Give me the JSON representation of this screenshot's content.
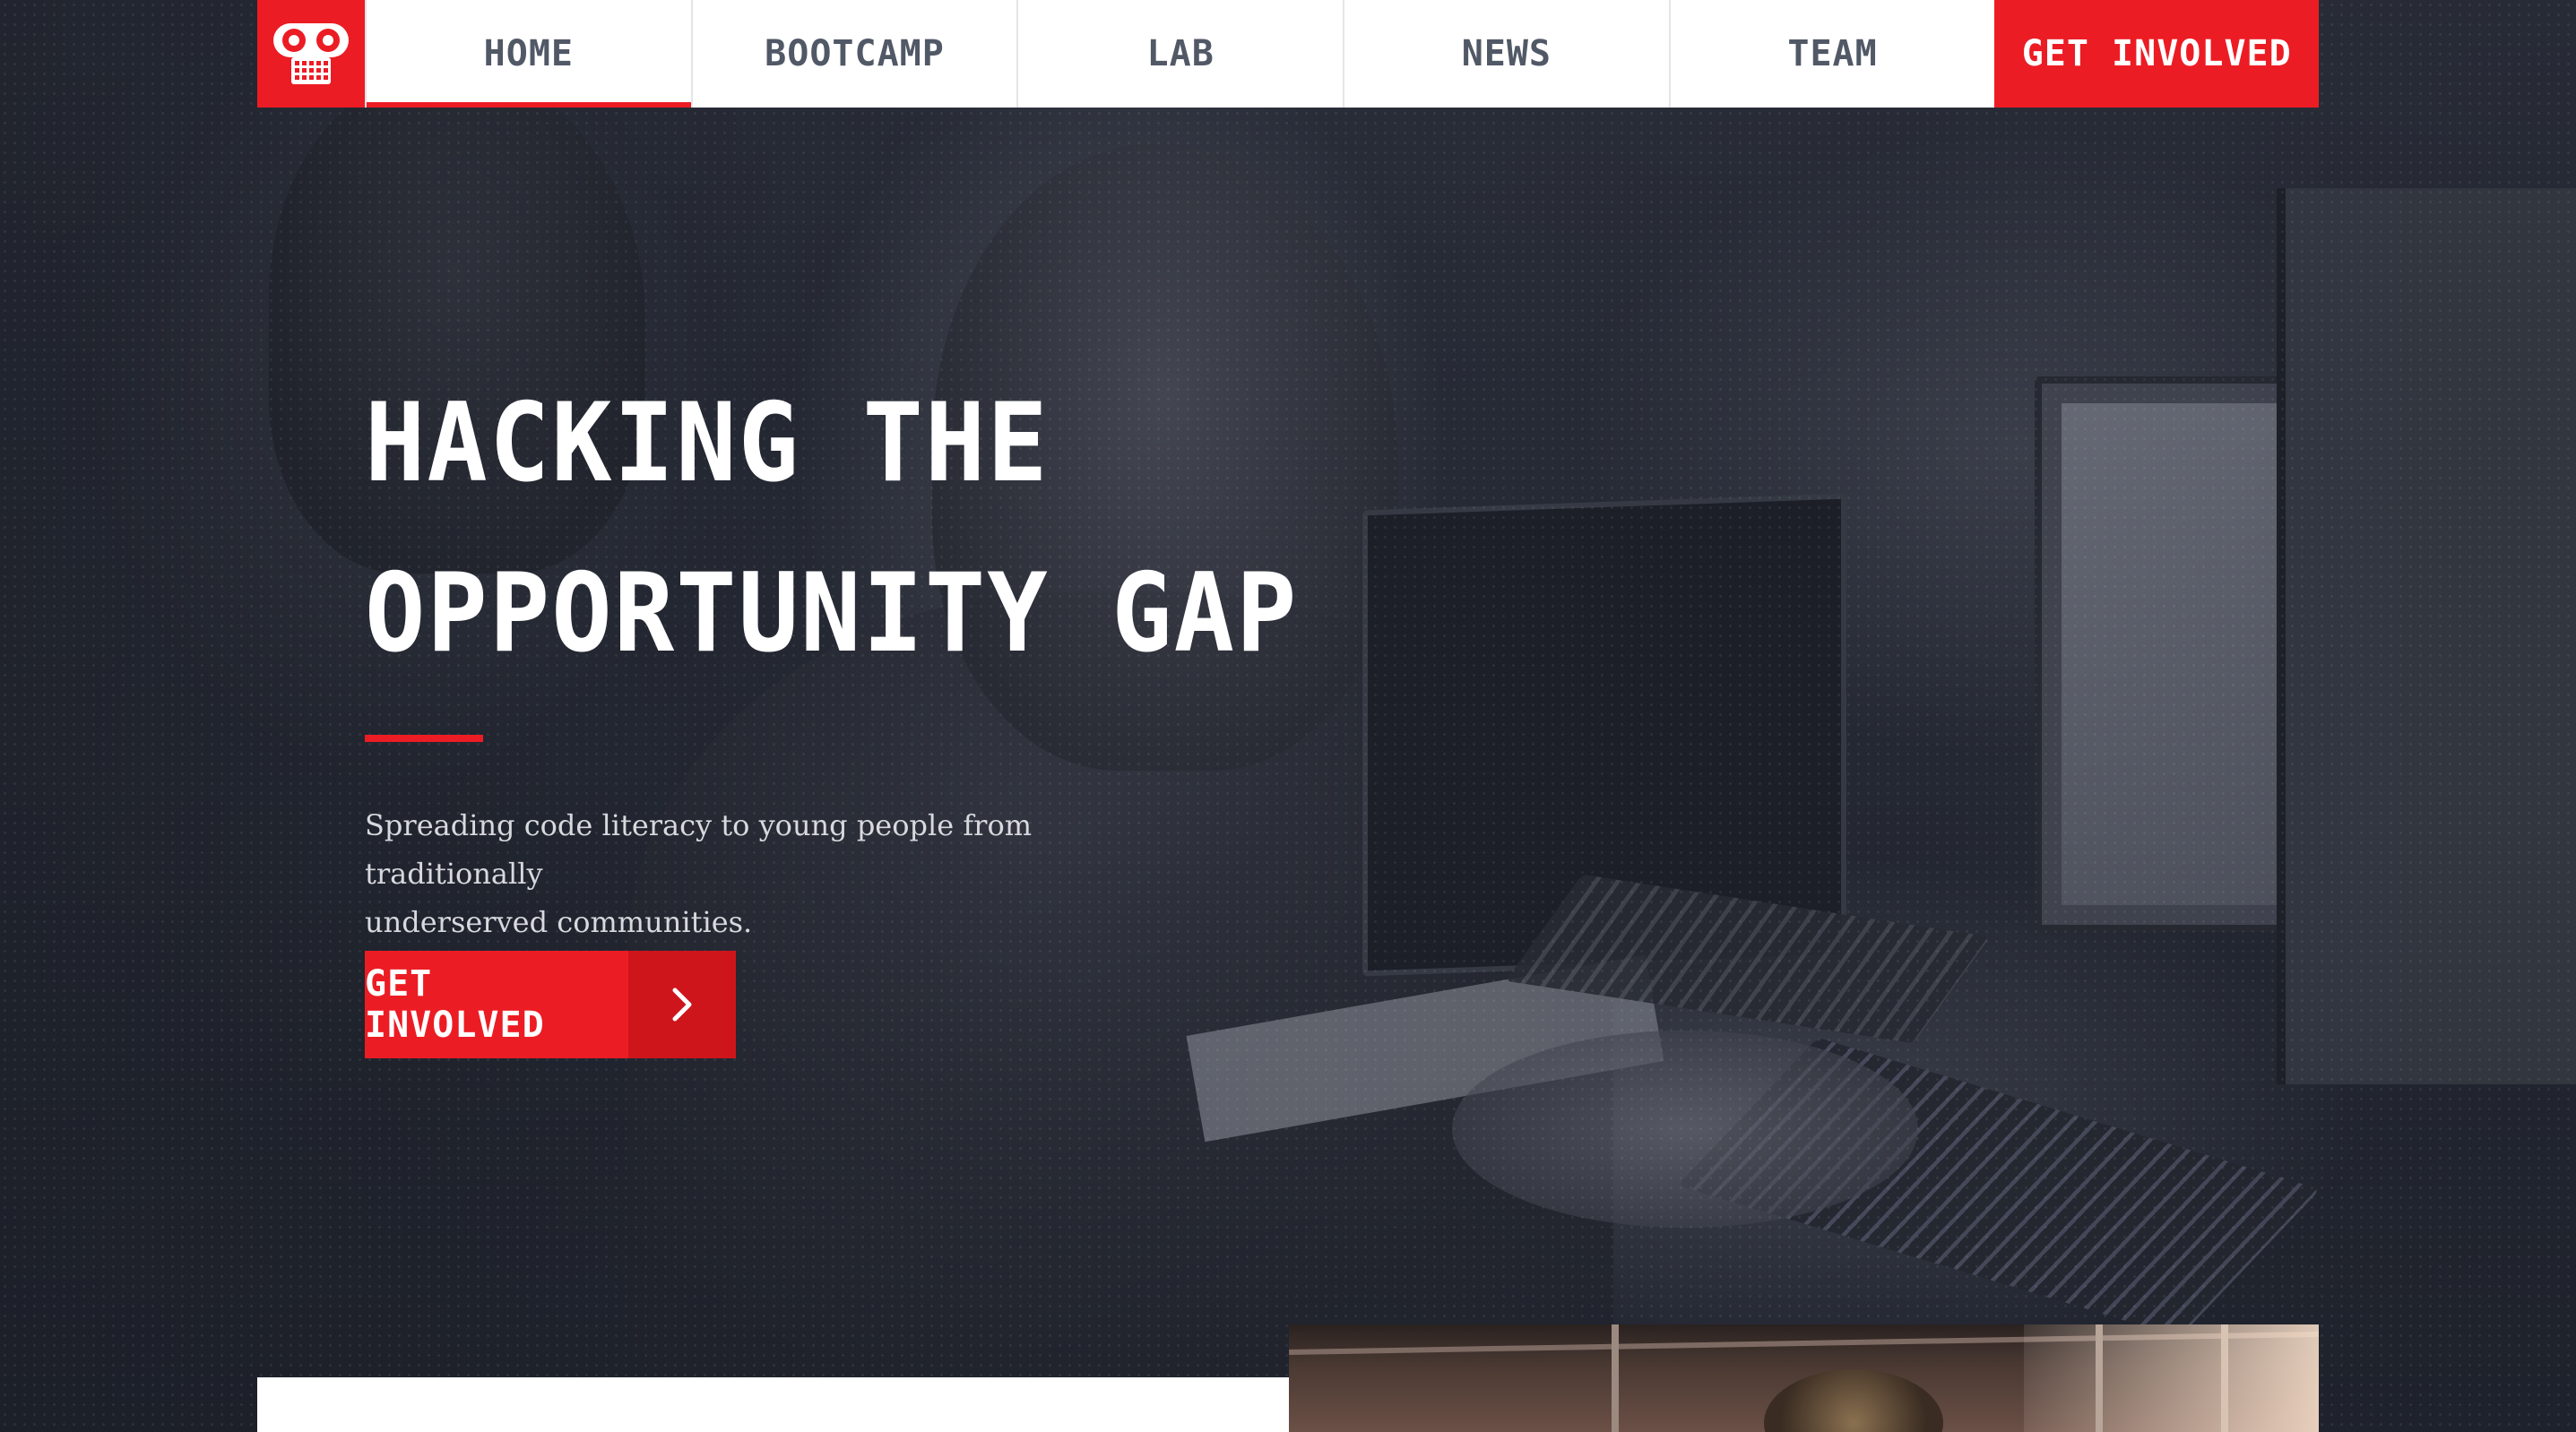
{
  "nav": {
    "logo_icon": "robot-logo-icon",
    "items": [
      {
        "label": "HOME",
        "active": true
      },
      {
        "label": "BOOTCAMP",
        "active": false
      },
      {
        "label": "LAB",
        "active": false
      },
      {
        "label": "NEWS",
        "active": false
      },
      {
        "label": "TEAM",
        "active": false
      }
    ],
    "cta_label": "GET INVOLVED"
  },
  "hero": {
    "title_line1": "HACKING THE",
    "title_line2": "OPPORTUNITY GAP",
    "subtitle_line1": "Spreading code literacy to young people from traditionally",
    "subtitle_line2": "underserved communities.",
    "button_label": "GET INVOLVED",
    "button_icon": "chevron-right-icon"
  },
  "colors": {
    "accent": "#ec1c24",
    "accent_dark": "#cf151c",
    "nav_text": "#515866",
    "hero_bg": "#242833"
  }
}
